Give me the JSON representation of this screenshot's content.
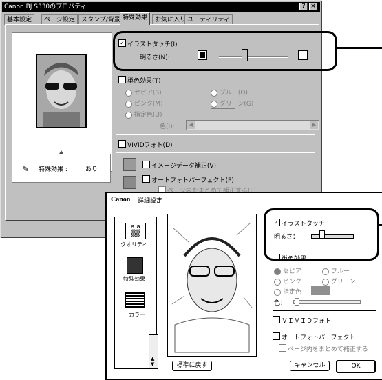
{
  "window": {
    "title": "Canon BJ S330のプロパティ",
    "help_button": "?",
    "close_button": "×",
    "tabs": [
      "基本設定",
      "ページ設定",
      "スタンプ/背景",
      "特殊効果",
      "お気に入り",
      "ユーティリティ"
    ],
    "active_tab": "特殊効果",
    "illust_touch_label": "イラストタッチ(I)",
    "brightness_label": "明るさ(N):",
    "mono_effect_label": "単色効果(T)",
    "radios": [
      "セピア(S)",
      "ブルー(Q)",
      "ピンク(M)",
      "グリーン(G)",
      "指定色(U)"
    ],
    "color_label": "色(I):",
    "vivid_label": "VIVIDフォト(D)",
    "info_label": "特殊効果 :",
    "info_value": "あり",
    "image_data_label": "イメージデータ補正(V)",
    "auto_photo_label": "オートフォトパーフェクト(P)",
    "page_correct_label": "ページ内をまとめて補正する(L)"
  },
  "dialog": {
    "title_brand": "Canon",
    "title_text": "詳細設定",
    "sidebar": [
      "クオリティ",
      "特殊効果",
      "カラー"
    ],
    "illust_touch_label": "イラストタッチ",
    "brightness_label": "明るさ：",
    "mono_effect_label": "単色効果",
    "radios": [
      "セピア",
      "ブルー",
      "ピンク",
      "グリーン",
      "指定色"
    ],
    "color_label": "色：",
    "vivid_label": "ＶＩＶＩＤフォト",
    "auto_photo_label": "オートフォトパーフェクト",
    "page_correct_label": "ページ内をまとめて補正する",
    "reset_button": "標準に戻す",
    "cancel_button": "キャンセル",
    "ok_button": "OK"
  },
  "colors": {
    "window_bg": "#c0c0c0",
    "titlebar": "#000000",
    "swatch": "#8f8f8f"
  }
}
